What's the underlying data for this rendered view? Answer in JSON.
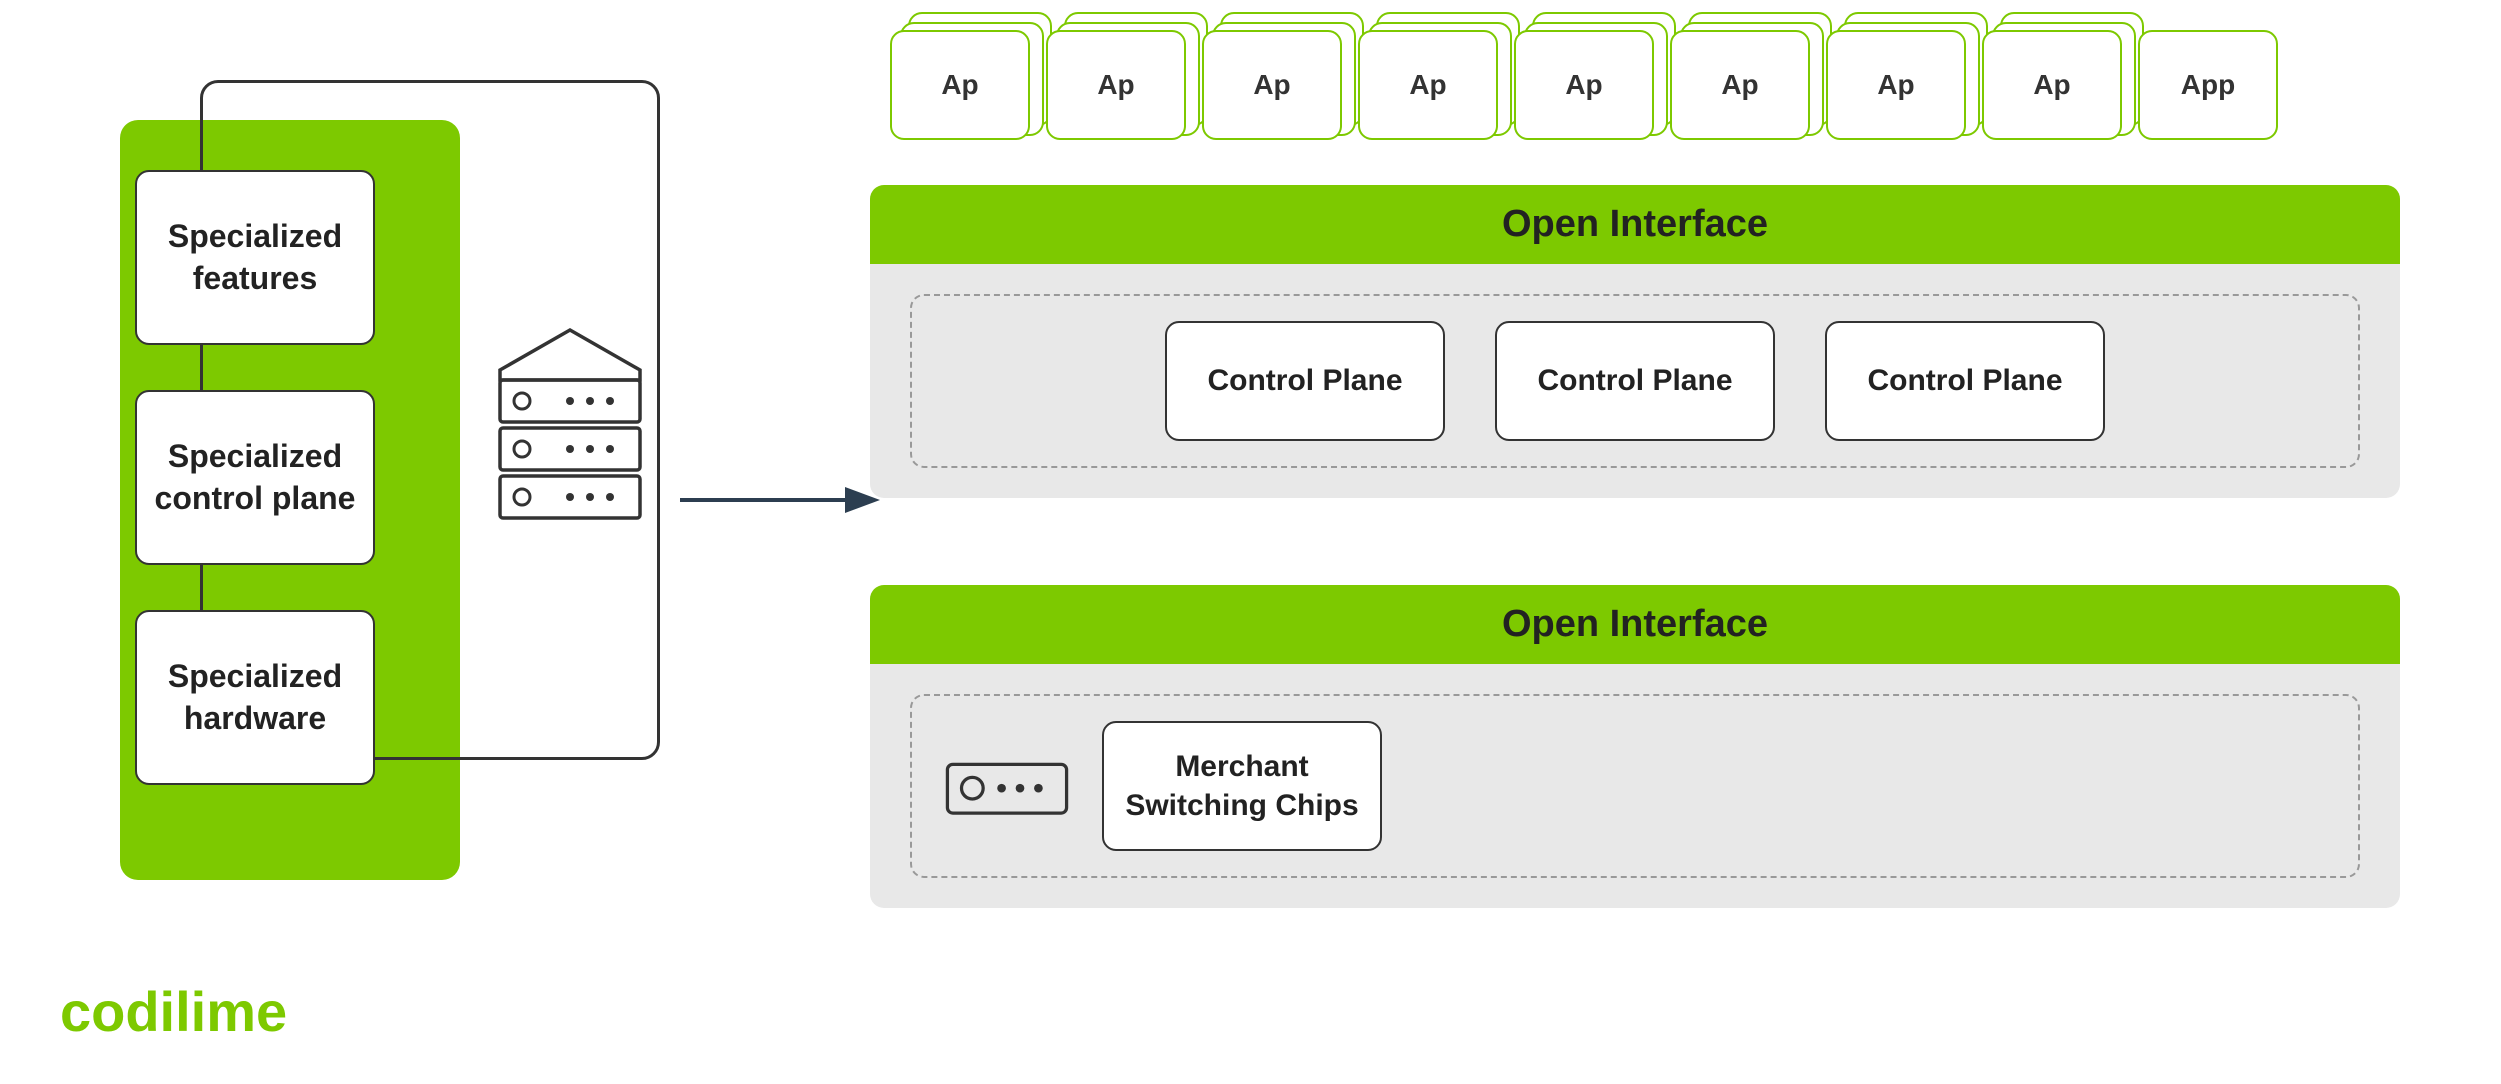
{
  "left": {
    "box_features_label": "Specialized\nfeatures",
    "box_control_label": "Specialized\ncontrol plane",
    "box_hardware_label": "Specialized\nhardware"
  },
  "right": {
    "apps": [
      "App",
      "App",
      "App",
      "App",
      "App",
      "App",
      "App",
      "App",
      "App"
    ],
    "open_interface_label": "Open Interface",
    "control_planes": [
      "Control Plane",
      "Control Plane",
      "Control Plane"
    ],
    "merchant_chips_label": "Merchant\nSwitching Chips"
  },
  "logo": {
    "codi": "codi",
    "lime": "lime"
  }
}
